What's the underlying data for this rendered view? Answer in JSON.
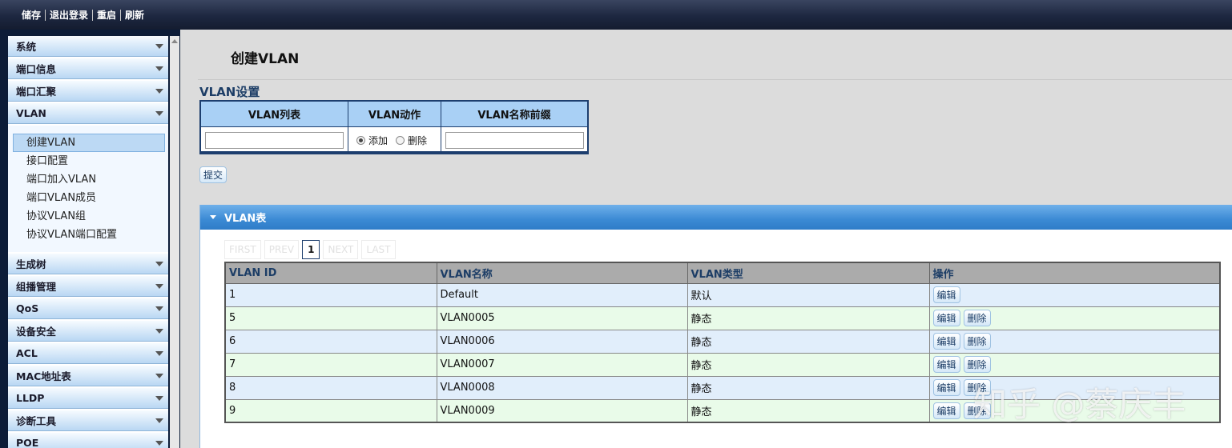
{
  "topbar": {
    "items": [
      "储存",
      "退出登录",
      "重启",
      "刷新"
    ]
  },
  "sidebar": {
    "sections_top": [
      "系统",
      "端口信息",
      "端口汇聚"
    ],
    "open_section": "VLAN",
    "open_items": [
      "创建VLAN",
      "接口配置",
      "端口加入VLAN",
      "端口VLAN成员",
      "协议VLAN组",
      "协议VLAN端口配置"
    ],
    "active_item": "创建VLAN",
    "sections_bottom": [
      "生成树",
      "组播管理",
      "QoS",
      "设备安全",
      "ACL",
      "MAC地址表",
      "LLDP",
      "诊断工具",
      "POE"
    ]
  },
  "main": {
    "title": "创建VLAN",
    "settings": {
      "title": "VLAN设置",
      "col_list": "VLAN列表",
      "col_action": "VLAN动作",
      "col_prefix": "VLAN名称前缀",
      "radio_add": "添加",
      "radio_delete": "删除",
      "selected_action": "添加",
      "list_value": "",
      "prefix_value": ""
    },
    "submit_label": "提交",
    "table_panel": {
      "title": "VLAN表",
      "pager": {
        "first": "FIRST",
        "prev": "PREV",
        "current": "1",
        "next": "NEXT",
        "last": "LAST"
      },
      "columns": [
        "VLAN ID",
        "VLAN名称",
        "VLAN类型",
        "操作"
      ],
      "rows": [
        {
          "id": "1",
          "name": "Default",
          "type": "默认",
          "actions": [
            "编辑"
          ]
        },
        {
          "id": "5",
          "name": "VLAN0005",
          "type": "静态",
          "actions": [
            "编辑",
            "删除"
          ]
        },
        {
          "id": "6",
          "name": "VLAN0006",
          "type": "静态",
          "actions": [
            "编辑",
            "删除"
          ]
        },
        {
          "id": "7",
          "name": "VLAN0007",
          "type": "静态",
          "actions": [
            "编辑",
            "删除"
          ]
        },
        {
          "id": "8",
          "name": "VLAN0008",
          "type": "静态",
          "actions": [
            "编辑",
            "删除"
          ]
        },
        {
          "id": "9",
          "name": "VLAN0009",
          "type": "静态",
          "actions": [
            "编辑",
            "删除"
          ]
        }
      ]
    }
  },
  "watermark": "知乎 @蔡庆丰"
}
